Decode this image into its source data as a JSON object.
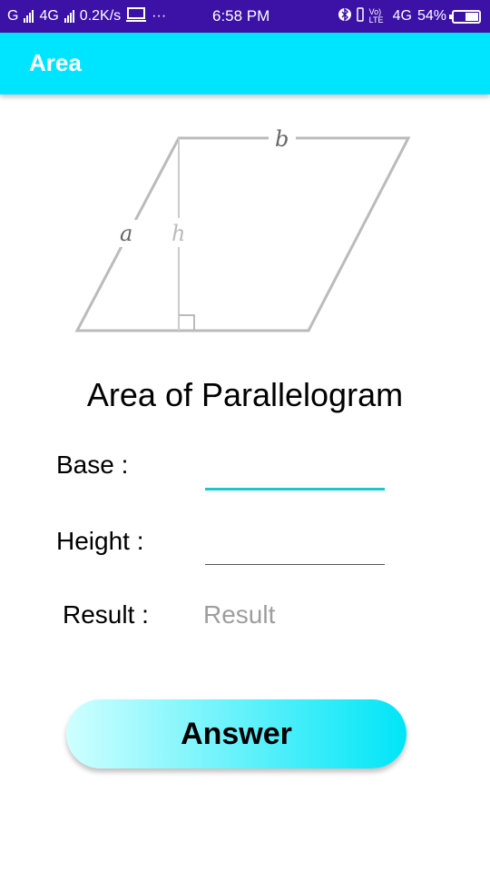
{
  "status_bar": {
    "network_left": "G",
    "network_4g": "4G",
    "speed": "0.2K/s",
    "more": "···",
    "time": "6:58 PM",
    "volte": "Vo) LTE",
    "network_right": "4G",
    "battery": "54%",
    "battery_level": 0.54
  },
  "app_bar": {
    "title": "Area"
  },
  "diagram": {
    "label_a": "a",
    "label_b": "b",
    "label_h": "h"
  },
  "main": {
    "heading": "Area of Parallelogram",
    "base_label": "Base :",
    "base_value": "",
    "height_label": "Height :",
    "height_value": "",
    "result_label": "Result :",
    "result_placeholder": "Result",
    "answer_button": "Answer"
  },
  "colors": {
    "status_bar": "#3c12a6",
    "app_bar": "#00e5ff",
    "input_focus_line": "#1ec8c8"
  }
}
